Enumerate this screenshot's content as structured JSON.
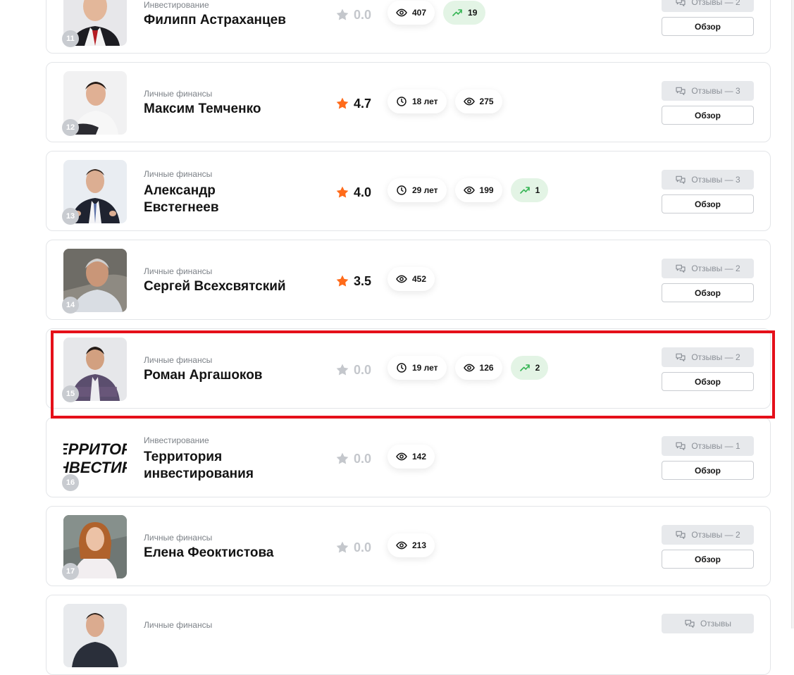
{
  "colors": {
    "star_active": "#ff6b1a",
    "star_inactive": "#c4c7cc",
    "trend_bg": "#e3f4e5",
    "trend_arrow": "#34b453",
    "highlight": "#e5101a"
  },
  "cards": [
    {
      "rank": "11",
      "category": "Инвестирование",
      "name_line1": "Филипп Астраханцев",
      "name_line2": "",
      "rating": "0.0",
      "experience": "",
      "views": "407",
      "trend": "19",
      "reviews": "Отзывы — 2",
      "review_label": "Обзор"
    },
    {
      "rank": "12",
      "category": "Личные финансы",
      "name_line1": "Максим Темченко",
      "name_line2": "",
      "rating": "4.7",
      "experience": "18 лет",
      "views": "275",
      "trend": "",
      "reviews": "Отзывы — 3",
      "review_label": "Обзор"
    },
    {
      "rank": "13",
      "category": "Личные финансы",
      "name_line1": "Александр",
      "name_line2": "Евстегнеев",
      "rating": "4.0",
      "experience": "29 лет",
      "views": "199",
      "trend": "1",
      "reviews": "Отзывы — 3",
      "review_label": "Обзор"
    },
    {
      "rank": "14",
      "category": "Личные финансы",
      "name_line1": "Сергей Всехсвятский",
      "name_line2": "",
      "rating": "3.5",
      "experience": "",
      "views": "452",
      "trend": "",
      "reviews": "Отзывы — 2",
      "review_label": "Обзор"
    },
    {
      "rank": "15",
      "category": "Личные финансы",
      "name_line1": "Роман Аргашоков",
      "name_line2": "",
      "rating": "0.0",
      "experience": "19 лет",
      "views": "126",
      "trend": "2",
      "reviews": "Отзывы — 2",
      "review_label": "Обзор"
    },
    {
      "rank": "16",
      "category": "Инвестирование",
      "name_line1": "Территория",
      "name_line2": "инвестирования",
      "rating": "0.0",
      "experience": "",
      "views": "142",
      "trend": "",
      "reviews": "Отзывы — 1",
      "review_label": "Обзор",
      "logo_line1": "ЕРРИТОРИ",
      "logo_line2": "НВЕСТИР"
    },
    {
      "rank": "17",
      "category": "Личные финансы",
      "name_line1": "Елена Феоктистова",
      "name_line2": "",
      "rating": "0.0",
      "experience": "",
      "views": "213",
      "trend": "",
      "reviews": "Отзывы — 2",
      "review_label": "Обзор"
    },
    {
      "rank": "",
      "category": "Личные финансы",
      "name_line1": "",
      "name_line2": "",
      "rating": "",
      "experience": "",
      "views": "",
      "trend": "",
      "reviews": "Отзывы",
      "review_label": ""
    }
  ]
}
